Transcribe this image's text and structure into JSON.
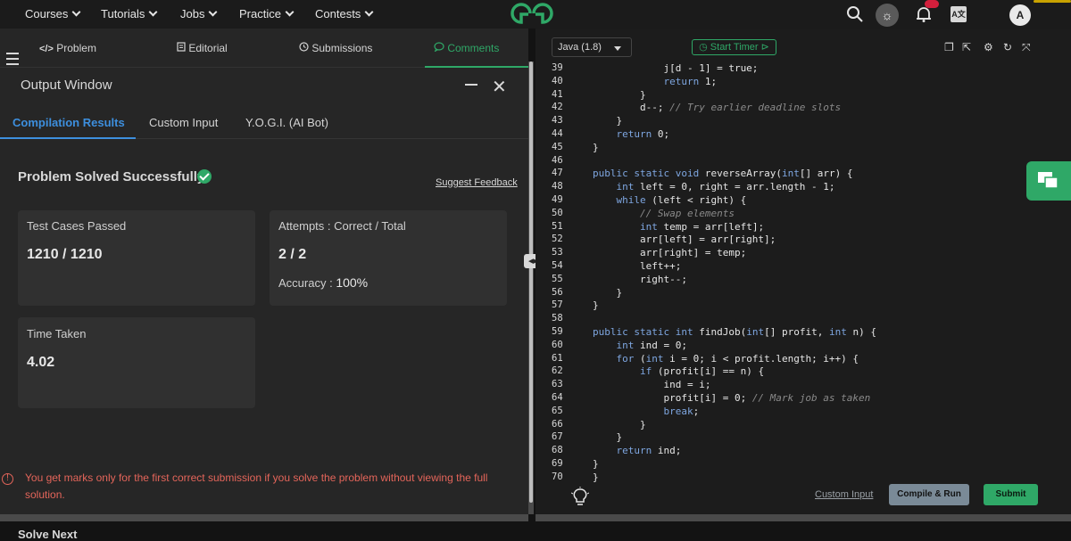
{
  "nav": {
    "items": [
      "Courses",
      "Tutorials",
      "Jobs",
      "Practice",
      "Contests"
    ],
    "avatar_letter": "A"
  },
  "tabs": [
    {
      "label": "Problem",
      "icon": "code-icon"
    },
    {
      "label": "Editorial",
      "icon": "document-icon"
    },
    {
      "label": "Submissions",
      "icon": "clock-icon"
    },
    {
      "label": "Comments",
      "icon": "chat-icon"
    }
  ],
  "output": {
    "title": "Output Window",
    "subtabs": [
      "Compilation Results",
      "Custom Input",
      "Y.O.G.I. (AI Bot)"
    ],
    "status": "Problem Solved Successfully",
    "suggest": "Suggest Feedback",
    "test_cases_label": "Test Cases Passed",
    "test_cases_value": "1210 / 1210",
    "attempts_label": "Attempts : Correct / Total",
    "attempts_value": "2 / 2",
    "accuracy_label": "Accuracy :",
    "accuracy_value": "100%",
    "time_label": "Time Taken",
    "time_value": "4.02",
    "warning": "You get marks only for the first correct submission if you solve the problem without viewing the full solution.",
    "solve_next": "Solve Next"
  },
  "editor": {
    "language": "Java (1.8)",
    "timer_label": "Start Timer",
    "custom_input": "Custom Input",
    "compile_label": "Compile & Run",
    "submit_label": "Submit",
    "lines": [
      {
        "n": "39",
        "code": "            j[d - 1] = true;"
      },
      {
        "n": "40",
        "code": "            return 1;"
      },
      {
        "n": "41",
        "code": "        }"
      },
      {
        "n": "42",
        "code": "        d--; // Try earlier deadline slots"
      },
      {
        "n": "43",
        "code": "    }"
      },
      {
        "n": "44",
        "code": "    return 0;"
      },
      {
        "n": "45",
        "code": "}"
      },
      {
        "n": "46",
        "code": ""
      },
      {
        "n": "47",
        "code": "public static void reverseArray(int[] arr) {"
      },
      {
        "n": "48",
        "code": "    int left = 0, right = arr.length - 1;"
      },
      {
        "n": "49",
        "code": "    while (left < right) {"
      },
      {
        "n": "50",
        "code": "        // Swap elements"
      },
      {
        "n": "51",
        "code": "        int temp = arr[left];"
      },
      {
        "n": "52",
        "code": "        arr[left] = arr[right];"
      },
      {
        "n": "53",
        "code": "        arr[right] = temp;"
      },
      {
        "n": "54",
        "code": "        left++;"
      },
      {
        "n": "55",
        "code": "        right--;"
      },
      {
        "n": "56",
        "code": "    }"
      },
      {
        "n": "57",
        "code": "}"
      },
      {
        "n": "58",
        "code": ""
      },
      {
        "n": "59",
        "code": "public static int findJob(int[] profit, int n) {"
      },
      {
        "n": "60",
        "code": "    int ind = 0;"
      },
      {
        "n": "61",
        "code": "    for (int i = 0; i < profit.length; i++) {"
      },
      {
        "n": "62",
        "code": "        if (profit[i] == n) {"
      },
      {
        "n": "63",
        "code": "            ind = i;"
      },
      {
        "n": "64",
        "code": "            profit[i] = 0; // Mark job as taken"
      },
      {
        "n": "65",
        "code": "            break;"
      },
      {
        "n": "66",
        "code": "        }"
      },
      {
        "n": "67",
        "code": "    }"
      },
      {
        "n": "68",
        "code": "    return ind;"
      },
      {
        "n": "69",
        "code": "}"
      },
      {
        "n": "70",
        "code": "}"
      }
    ]
  },
  "colors": {
    "accent_green": "#2fa867",
    "accent_blue": "#3d8fde",
    "warning_red": "#e4655a",
    "keyword": "#7ea6e0",
    "comment": "#8a8a8a"
  }
}
